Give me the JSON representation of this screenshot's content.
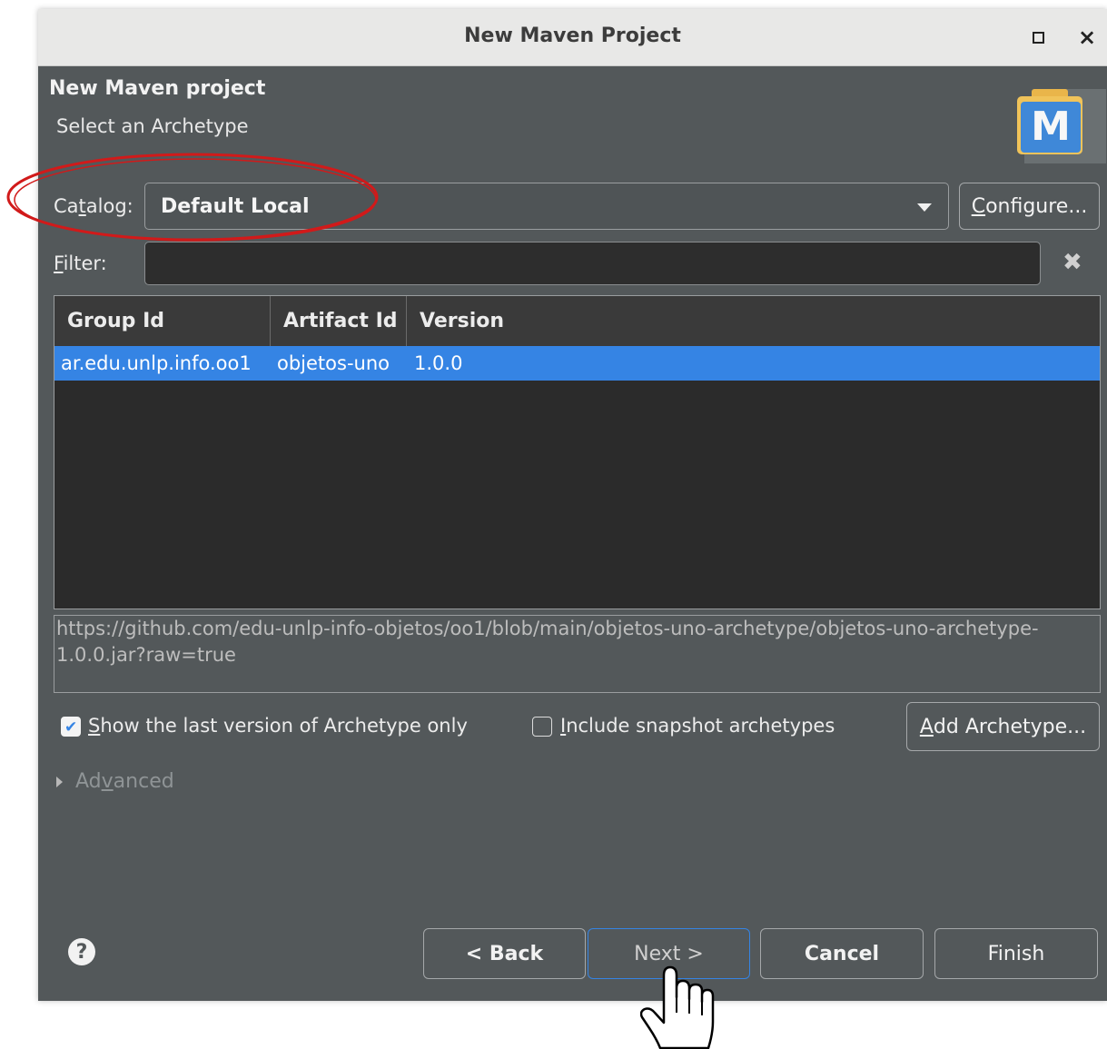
{
  "window": {
    "title": "New Maven Project"
  },
  "header": {
    "title": "New Maven project",
    "subtitle": "Select an Archetype"
  },
  "catalog": {
    "label_pre": "Ca",
    "label_mnemonic": "t",
    "label_post": "alog:",
    "selected": "Default Local",
    "configure_mnemonic": "C",
    "configure_rest": "onfigure..."
  },
  "filter": {
    "label_mnemonic": "F",
    "label_rest": "ilter:",
    "value": ""
  },
  "table": {
    "columns": [
      "Group Id",
      "Artifact Id",
      "Version"
    ],
    "rows": [
      {
        "group_id": "ar.edu.unlp.info.oo1",
        "artifact_id": "objetos-uno",
        "version": "1.0.0"
      }
    ]
  },
  "description": "https://github.com/edu-unlp-info-objetos/oo1/blob/main/objetos-uno-archetype/objetos-uno-archetype-1.0.0.jar?raw=true",
  "options": {
    "show_last_mnemonic": "S",
    "show_last_rest": "how the last version of Archetype only",
    "show_last_checked": true,
    "include_snapshot_mnemonic": "I",
    "include_snapshot_rest": "nclude snapshot archetypes",
    "include_snapshot_checked": false,
    "add_archetype_mnemonic": "A",
    "add_archetype_rest": "dd Archetype..."
  },
  "advanced": {
    "pre": "Ad",
    "mnemonic": "v",
    "post": "anced"
  },
  "footer": {
    "back": "< Back",
    "next": "Next >",
    "cancel": "Cancel",
    "finish": "Finish"
  },
  "icons": {
    "maximize": "maximize-icon",
    "close": "close-icon",
    "maven": "maven-icon",
    "clear": "clear-icon",
    "help": "help-icon",
    "cursor": "hand-cursor-icon"
  },
  "colors": {
    "selection": "#3584e4",
    "annotation": "#d11a1a",
    "dialog_bg": "#53585a"
  }
}
